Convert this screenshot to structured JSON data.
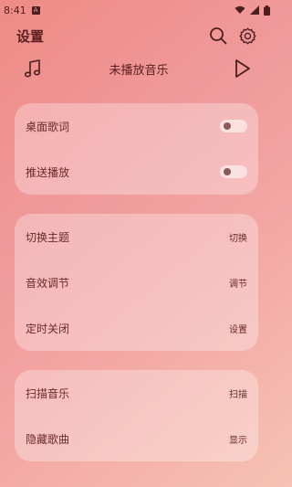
{
  "status_bar": {
    "time": "8:41",
    "notif_glyph": "A"
  },
  "header": {
    "title": "设置"
  },
  "player": {
    "now_playing": "未播放音乐"
  },
  "group1": {
    "items": [
      {
        "label": "桌面歌词",
        "enabled": false
      },
      {
        "label": "推送播放",
        "enabled": false
      }
    ]
  },
  "group2": {
    "items": [
      {
        "label": "切换主题",
        "action": "切换"
      },
      {
        "label": "音效调节",
        "action": "调节"
      },
      {
        "label": "定时关闭",
        "action": "设置"
      }
    ]
  },
  "group3": {
    "items": [
      {
        "label": "扫描音乐",
        "action": "扫描"
      },
      {
        "label": "隐藏歌曲",
        "action": "显示"
      }
    ]
  }
}
